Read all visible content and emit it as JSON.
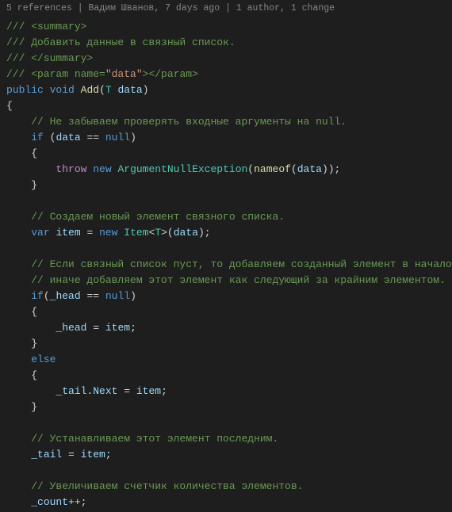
{
  "editor": {
    "meta": "5 references | Вадим Шванов, 7 days ago | 1 author, 1 change",
    "lines": [
      {
        "tokens": [
          {
            "cls": "c-green",
            "text": "/// <summary>"
          }
        ]
      },
      {
        "tokens": [
          {
            "cls": "c-green",
            "text": "/// Добавить данные в связный список."
          }
        ]
      },
      {
        "tokens": [
          {
            "cls": "c-green",
            "text": "/// </summary>"
          }
        ]
      },
      {
        "tokens": [
          {
            "cls": "c-green",
            "text": "/// <param name="
          },
          {
            "cls": "c-orange",
            "text": "\"data\""
          },
          {
            "cls": "c-green",
            "text": "></param>"
          }
        ]
      },
      {
        "tokens": [
          {
            "cls": "c-blue",
            "text": "public"
          },
          {
            "cls": "c-white",
            "text": " "
          },
          {
            "cls": "c-blue",
            "text": "void"
          },
          {
            "cls": "c-white",
            "text": " "
          },
          {
            "cls": "c-yellow",
            "text": "Add"
          },
          {
            "cls": "c-white",
            "text": "("
          },
          {
            "cls": "c-cyan",
            "text": "T"
          },
          {
            "cls": "c-white",
            "text": " "
          },
          {
            "cls": "c-lightblue",
            "text": "data"
          },
          {
            "cls": "c-white",
            "text": ")"
          }
        ]
      },
      {
        "tokens": [
          {
            "cls": "c-white",
            "text": "{"
          }
        ]
      },
      {
        "tokens": [
          {
            "cls": "c-green",
            "text": "    // Не забываем проверять входные аргументы на null."
          }
        ]
      },
      {
        "tokens": [
          {
            "cls": "c-white",
            "text": "    "
          },
          {
            "cls": "c-blue",
            "text": "if"
          },
          {
            "cls": "c-white",
            "text": " ("
          },
          {
            "cls": "c-lightblue",
            "text": "data"
          },
          {
            "cls": "c-white",
            "text": " == "
          },
          {
            "cls": "c-blue",
            "text": "null"
          },
          {
            "cls": "c-white",
            "text": ")"
          }
        ]
      },
      {
        "tokens": [
          {
            "cls": "c-white",
            "text": "    {"
          }
        ]
      },
      {
        "tokens": [
          {
            "cls": "c-white",
            "text": "    "
          },
          {
            "cls": "c-purple",
            "text": "    throw"
          },
          {
            "cls": "c-white",
            "text": " "
          },
          {
            "cls": "c-blue",
            "text": "new"
          },
          {
            "cls": "c-white",
            "text": " "
          },
          {
            "cls": "c-cyan",
            "text": "ArgumentNullException"
          },
          {
            "cls": "c-white",
            "text": "("
          },
          {
            "cls": "c-yellow",
            "text": "nameof"
          },
          {
            "cls": "c-white",
            "text": "("
          },
          {
            "cls": "c-lightblue",
            "text": "data"
          },
          {
            "cls": "c-white",
            "text": "));"
          }
        ]
      },
      {
        "tokens": [
          {
            "cls": "c-white",
            "text": "    }"
          }
        ]
      },
      {
        "tokens": []
      },
      {
        "tokens": [
          {
            "cls": "c-green",
            "text": "    // Создаем новый элемент связного списка."
          }
        ]
      },
      {
        "tokens": [
          {
            "cls": "c-white",
            "text": "    "
          },
          {
            "cls": "c-blue",
            "text": "var"
          },
          {
            "cls": "c-white",
            "text": " "
          },
          {
            "cls": "c-lightblue",
            "text": "item"
          },
          {
            "cls": "c-white",
            "text": " = "
          },
          {
            "cls": "c-blue",
            "text": "new"
          },
          {
            "cls": "c-white",
            "text": " "
          },
          {
            "cls": "c-cyan",
            "text": "Item"
          },
          {
            "cls": "c-white",
            "text": "<"
          },
          {
            "cls": "c-cyan",
            "text": "T"
          },
          {
            "cls": "c-white",
            "text": ">("
          },
          {
            "cls": "c-lightblue",
            "text": "data"
          },
          {
            "cls": "c-white",
            "text": ");"
          }
        ]
      },
      {
        "tokens": []
      },
      {
        "tokens": [
          {
            "cls": "c-green",
            "text": "    // Если связный список пуст, то добавляем созданный элемент в начало,"
          }
        ]
      },
      {
        "tokens": [
          {
            "cls": "c-green",
            "text": "    // иначе добавляем этот элемент как следующий за крайним элементом."
          }
        ]
      },
      {
        "tokens": [
          {
            "cls": "c-white",
            "text": "    "
          },
          {
            "cls": "c-blue",
            "text": "if"
          },
          {
            "cls": "c-white",
            "text": "("
          },
          {
            "cls": "c-lightblue",
            "text": "_head"
          },
          {
            "cls": "c-white",
            "text": " == "
          },
          {
            "cls": "c-blue",
            "text": "null"
          },
          {
            "cls": "c-white",
            "text": ")"
          }
        ]
      },
      {
        "tokens": [
          {
            "cls": "c-white",
            "text": "    {"
          }
        ]
      },
      {
        "tokens": [
          {
            "cls": "c-white",
            "text": "    "
          },
          {
            "cls": "c-lightblue",
            "text": "    _head"
          },
          {
            "cls": "c-white",
            "text": " = "
          },
          {
            "cls": "c-lightblue",
            "text": "item"
          },
          {
            "cls": "c-white",
            "text": ";"
          }
        ]
      },
      {
        "tokens": [
          {
            "cls": "c-white",
            "text": "    }"
          }
        ]
      },
      {
        "tokens": [
          {
            "cls": "c-blue",
            "text": "    else"
          }
        ]
      },
      {
        "tokens": [
          {
            "cls": "c-white",
            "text": "    {"
          }
        ]
      },
      {
        "tokens": [
          {
            "cls": "c-white",
            "text": "    "
          },
          {
            "cls": "c-lightblue",
            "text": "    _tail"
          },
          {
            "cls": "c-white",
            "text": "."
          },
          {
            "cls": "c-lightblue",
            "text": "Next"
          },
          {
            "cls": "c-white",
            "text": " = "
          },
          {
            "cls": "c-lightblue",
            "text": "item"
          },
          {
            "cls": "c-white",
            "text": ";"
          }
        ]
      },
      {
        "tokens": [
          {
            "cls": "c-white",
            "text": "    }"
          }
        ]
      },
      {
        "tokens": []
      },
      {
        "tokens": [
          {
            "cls": "c-green",
            "text": "    // Устанавливаем этот элемент последним."
          }
        ]
      },
      {
        "tokens": [
          {
            "cls": "c-white",
            "text": "    "
          },
          {
            "cls": "c-lightblue",
            "text": "_tail"
          },
          {
            "cls": "c-white",
            "text": " = "
          },
          {
            "cls": "c-lightblue",
            "text": "item"
          },
          {
            "cls": "c-white",
            "text": ";"
          }
        ]
      },
      {
        "tokens": []
      },
      {
        "tokens": [
          {
            "cls": "c-green",
            "text": "    // Увеличиваем счетчик количества элементов."
          }
        ]
      },
      {
        "tokens": [
          {
            "cls": "c-white",
            "text": "    "
          },
          {
            "cls": "c-lightblue",
            "text": "_count"
          },
          {
            "cls": "c-white",
            "text": "++;"
          }
        ]
      }
    ]
  }
}
